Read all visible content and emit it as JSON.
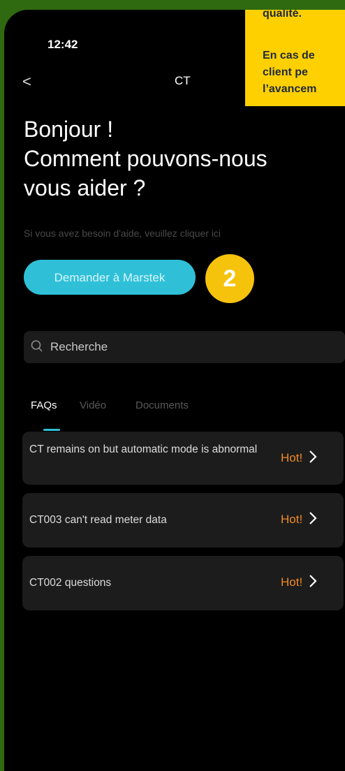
{
  "status": {
    "time": "12:42"
  },
  "nav": {
    "back_glyph": "<",
    "title": "CT"
  },
  "greeting": {
    "line1": "Bonjour !",
    "line2": "Comment pouvons-nous",
    "line3": "vous aider ?"
  },
  "help_text": "Si vous avez besoin d'aide, veuillez cliquer ici",
  "ask_button": "Demander à Marstek",
  "step_badge": "2",
  "search": {
    "placeholder": "Recherche",
    "icon": "search-icon"
  },
  "tabs": [
    {
      "label": "FAQs",
      "active": true
    },
    {
      "label": "Vidéo",
      "active": false
    },
    {
      "label": "Documents",
      "active": false
    }
  ],
  "faqs": [
    {
      "question": "CT remains on but automatic mode is abnormal",
      "badge": "Hot!"
    },
    {
      "question": "CT003 can't read meter data",
      "badge": "Hot!"
    },
    {
      "question": "CT002 questions",
      "badge": "Hot!"
    }
  ],
  "callout": {
    "line1": "qualité.",
    "line2": "En cas de",
    "line3": "client pe",
    "line4": "l’avancem"
  },
  "colors": {
    "accent": "#2fc0d8",
    "hot": "#f08a24",
    "badge": "#f6c30c",
    "callout": "#ffd000",
    "frame": "#2f6a10"
  }
}
